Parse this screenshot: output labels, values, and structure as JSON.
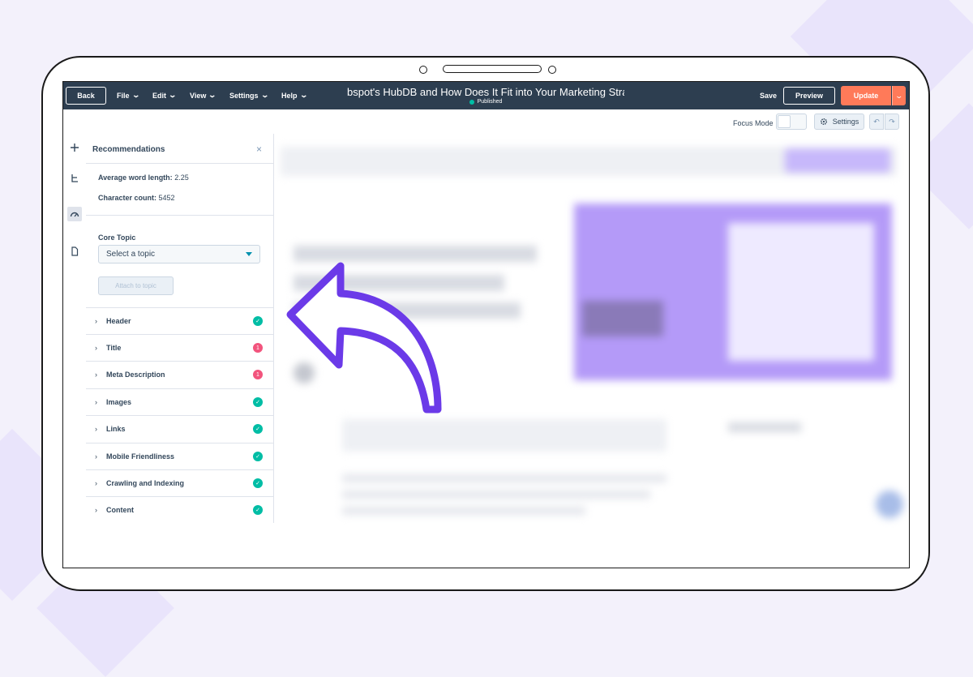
{
  "colors": {
    "topbar": "#2d3e50",
    "accent_orange": "#ff7a59",
    "success": "#00bda5",
    "error": "#f2547d",
    "arrow_purple": "#6b3ae8"
  },
  "topbar": {
    "back": "Back",
    "menus": [
      "File",
      "Edit",
      "View",
      "Settings",
      "Help"
    ],
    "doc_title": "bspot's HubDB and How Does It Fit into Your Marketing Stra",
    "status": "Published",
    "save": "Save",
    "preview": "Preview",
    "update": "Update"
  },
  "subbar": {
    "focus_mode": "Focus Mode",
    "settings": "Settings"
  },
  "rail_icons": [
    "plus-icon",
    "tree-icon",
    "gauge-icon",
    "page-icon"
  ],
  "panel": {
    "title": "Recommendations",
    "avg_word_label": "Average word length:",
    "avg_word_value": "2.25",
    "char_count_label": "Character count:",
    "char_count_value": "5452",
    "core_topic_label": "Core Topic",
    "select_placeholder": "Select a topic",
    "attach_button": "Attach to topic",
    "items": [
      {
        "label": "Header",
        "status": "ok",
        "badge": ""
      },
      {
        "label": "Title",
        "status": "err",
        "badge": "1"
      },
      {
        "label": "Meta Description",
        "status": "err",
        "badge": "1"
      },
      {
        "label": "Images",
        "status": "ok",
        "badge": ""
      },
      {
        "label": "Links",
        "status": "ok",
        "badge": ""
      },
      {
        "label": "Mobile Friendliness",
        "status": "ok",
        "badge": ""
      },
      {
        "label": "Crawling and Indexing",
        "status": "ok",
        "badge": ""
      },
      {
        "label": "Content",
        "status": "ok",
        "badge": ""
      }
    ]
  }
}
